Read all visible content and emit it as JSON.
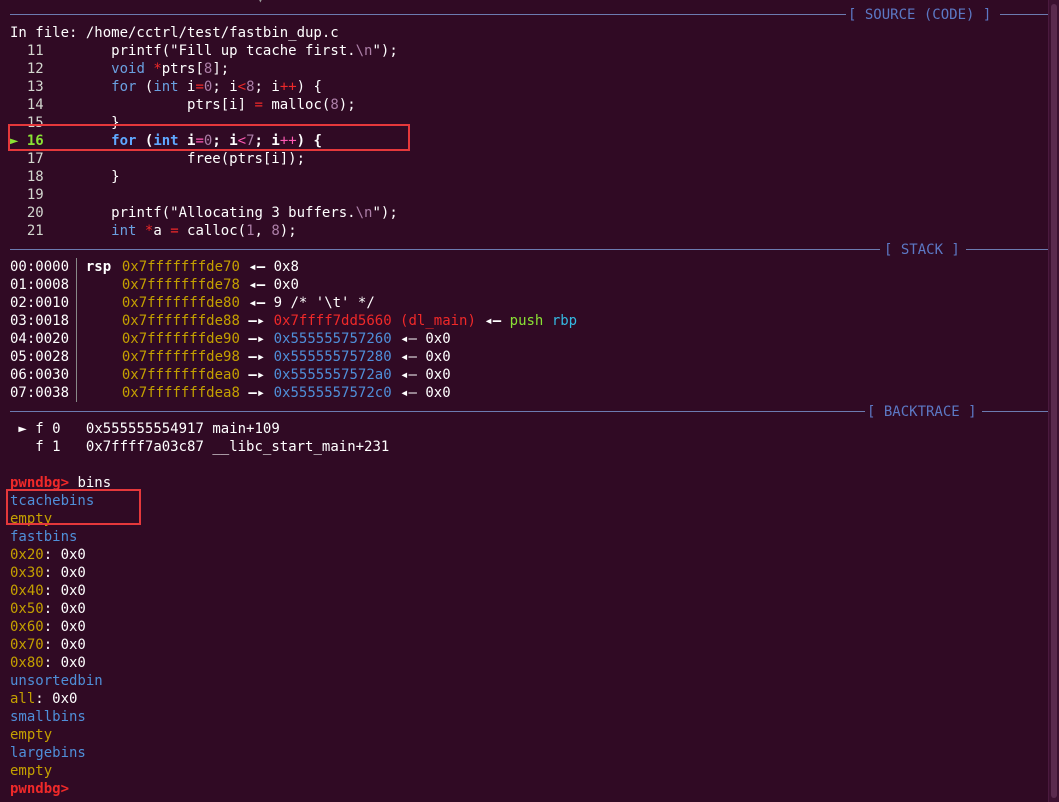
{
  "terminal": {
    "sections": {
      "source": "[ SOURCE (CODE) ]",
      "stack": "[ STACK ]",
      "backtrace": "[ BACKTRACE ]"
    },
    "file_line": {
      "prefix": "In file: ",
      "path": "/home/cctrl/test/fastbin_dup.c"
    },
    "source_lines": [
      {
        "num": "11",
        "code": [
          {
            "t": "printf(",
            "c": "white"
          },
          {
            "t": "\"Fill up tcache first.",
            "c": "white"
          },
          {
            "t": "\\n",
            "c": "purple"
          },
          {
            "t": "\");",
            "c": "white"
          }
        ]
      },
      {
        "num": "12",
        "code": [
          {
            "t": "void",
            "c": "blue2"
          },
          {
            "t": " ",
            "c": "white"
          },
          {
            "t": "*",
            "c": "red"
          },
          {
            "t": "ptrs[",
            "c": "white"
          },
          {
            "t": "8",
            "c": "purple"
          },
          {
            "t": "];",
            "c": "white"
          }
        ]
      },
      {
        "num": "13",
        "code": [
          {
            "t": "for",
            "c": "blue2"
          },
          {
            "t": " (",
            "c": "white"
          },
          {
            "t": "int",
            "c": "blue2"
          },
          {
            "t": " i",
            "c": "white"
          },
          {
            "t": "=",
            "c": "red"
          },
          {
            "t": "0",
            "c": "purple"
          },
          {
            "t": "; i",
            "c": "white"
          },
          {
            "t": "<",
            "c": "red"
          },
          {
            "t": "8",
            "c": "purple"
          },
          {
            "t": "; i",
            "c": "white"
          },
          {
            "t": "++",
            "c": "red"
          },
          {
            "t": ") {",
            "c": "white"
          }
        ]
      },
      {
        "num": "14",
        "code": [
          {
            "t": "         ptrs[i] ",
            "c": "white"
          },
          {
            "t": "=",
            "c": "red"
          },
          {
            "t": " malloc(",
            "c": "white"
          },
          {
            "t": "8",
            "c": "purple"
          },
          {
            "t": ");",
            "c": "white"
          }
        ]
      },
      {
        "num": "15",
        "code": [
          {
            "t": "}",
            "c": "white"
          }
        ]
      },
      {
        "num": "16",
        "current": true,
        "code": [
          {
            "t": "for",
            "c": "kw"
          },
          {
            "t": " (",
            "c": "white"
          },
          {
            "t": "int",
            "c": "kw"
          },
          {
            "t": " i",
            "c": "white"
          },
          {
            "t": "=",
            "c": "pink"
          },
          {
            "t": "0",
            "c": "purple"
          },
          {
            "t": "; i",
            "c": "white"
          },
          {
            "t": "<",
            "c": "pink"
          },
          {
            "t": "7",
            "c": "purple"
          },
          {
            "t": "; i",
            "c": "white"
          },
          {
            "t": "++",
            "c": "pink"
          },
          {
            "t": ") {",
            "c": "white"
          }
        ]
      },
      {
        "num": "17",
        "code": [
          {
            "t": "         free(ptrs[i]);",
            "c": "white"
          }
        ]
      },
      {
        "num": "18",
        "code": [
          {
            "t": "}",
            "c": "white"
          }
        ]
      },
      {
        "num": "19",
        "code": []
      },
      {
        "num": "20",
        "code": [
          {
            "t": "printf(",
            "c": "white"
          },
          {
            "t": "\"Allocating 3 buffers.",
            "c": "white"
          },
          {
            "t": "\\n",
            "c": "purple"
          },
          {
            "t": "\");",
            "c": "white"
          }
        ]
      },
      {
        "num": "21",
        "code": [
          {
            "t": "int",
            "c": "blue2"
          },
          {
            "t": " ",
            "c": "white"
          },
          {
            "t": "*",
            "c": "red"
          },
          {
            "t": "a ",
            "c": "white"
          },
          {
            "t": "=",
            "c": "red"
          },
          {
            "t": " calloc(",
            "c": "white"
          },
          {
            "t": "1",
            "c": "purple"
          },
          {
            "t": ", ",
            "c": "white"
          },
          {
            "t": "8",
            "c": "purple"
          },
          {
            "t": ");",
            "c": "white"
          }
        ]
      }
    ],
    "current_marker": "►",
    "stack_rows": [
      {
        "off": "00:0000",
        "reg": "rsp",
        "addr": "0x7fffffffde70",
        "arrow": "◂—",
        "target": "",
        "target_color": "",
        "tail": "0x8",
        "extra": ""
      },
      {
        "off": "01:0008",
        "reg": "",
        "addr": "0x7fffffffde78",
        "arrow": "◂—",
        "target": "",
        "target_color": "",
        "tail": "0x0",
        "extra": ""
      },
      {
        "off": "02:0010",
        "reg": "",
        "addr": "0x7fffffffde80",
        "arrow": "◂—",
        "target": "",
        "target_color": "",
        "tail": "9 /* '\\t' */",
        "extra": ""
      },
      {
        "off": "03:0018",
        "reg": "",
        "addr": "0x7fffffffde88",
        "arrow": "—▸",
        "target": "0x7ffff7dd5660 (dl_main)",
        "target_color": "red",
        "tail": "◂— push",
        "extra": "rbp"
      },
      {
        "off": "04:0020",
        "reg": "",
        "addr": "0x7fffffffde90",
        "arrow": "—▸",
        "target": "0x555555757260",
        "target_color": "blue",
        "tail": "◂— 0x0",
        "extra": ""
      },
      {
        "off": "05:0028",
        "reg": "",
        "addr": "0x7fffffffde98",
        "arrow": "—▸",
        "target": "0x555555757280",
        "target_color": "blue",
        "tail": "◂— 0x0",
        "extra": ""
      },
      {
        "off": "06:0030",
        "reg": "",
        "addr": "0x7fffffffdea0",
        "arrow": "—▸",
        "target": "0x5555557572a0",
        "target_color": "blue",
        "tail": "◂— 0x0",
        "extra": ""
      },
      {
        "off": "07:0038",
        "reg": "",
        "addr": "0x7fffffffdea8",
        "arrow": "—▸",
        "target": "0x5555557572c0",
        "target_color": "blue",
        "tail": "◂— 0x0",
        "extra": ""
      }
    ],
    "backtrace_rows": [
      {
        "marker": "►",
        "frame": "f 0",
        "addr": "0x555555554917",
        "sym": "main+109"
      },
      {
        "marker": "",
        "frame": "f 1",
        "addr": "0x7ffff7a03c87",
        "sym": "__libc_start_main+231"
      }
    ],
    "prompt": "pwndbg>",
    "command": "bins",
    "bins_output": [
      {
        "parts": [
          {
            "t": "tcachebins",
            "c": "blue"
          }
        ]
      },
      {
        "parts": [
          {
            "t": "empty",
            "c": "gold"
          }
        ]
      },
      {
        "parts": [
          {
            "t": "fastbins",
            "c": "blue"
          }
        ]
      },
      {
        "parts": [
          {
            "t": "0x20",
            "c": "gold"
          },
          {
            "t": ": 0x0",
            "c": "white"
          }
        ]
      },
      {
        "parts": [
          {
            "t": "0x30",
            "c": "gold"
          },
          {
            "t": ": 0x0",
            "c": "white"
          }
        ]
      },
      {
        "parts": [
          {
            "t": "0x40",
            "c": "gold"
          },
          {
            "t": ": 0x0",
            "c": "white"
          }
        ]
      },
      {
        "parts": [
          {
            "t": "0x50",
            "c": "gold"
          },
          {
            "t": ": 0x0",
            "c": "white"
          }
        ]
      },
      {
        "parts": [
          {
            "t": "0x60",
            "c": "gold"
          },
          {
            "t": ": 0x0",
            "c": "white"
          }
        ]
      },
      {
        "parts": [
          {
            "t": "0x70",
            "c": "gold"
          },
          {
            "t": ": 0x0",
            "c": "white"
          }
        ]
      },
      {
        "parts": [
          {
            "t": "0x80",
            "c": "gold"
          },
          {
            "t": ": 0x0",
            "c": "white"
          }
        ]
      },
      {
        "parts": [
          {
            "t": "unsortedbin",
            "c": "blue"
          }
        ]
      },
      {
        "parts": [
          {
            "t": "all",
            "c": "gold"
          },
          {
            "t": ": 0x0",
            "c": "white"
          }
        ]
      },
      {
        "parts": [
          {
            "t": "smallbins",
            "c": "blue"
          }
        ]
      },
      {
        "parts": [
          {
            "t": "empty",
            "c": "gold"
          }
        ]
      },
      {
        "parts": [
          {
            "t": "largebins",
            "c": "blue"
          }
        ]
      },
      {
        "parts": [
          {
            "t": "empty",
            "c": "gold"
          }
        ]
      }
    ],
    "final_prompt": "pwndbg>",
    "colors": {
      "background": "#300a24",
      "highlight_box": "#e5383b",
      "gold": "#c4a000",
      "blue": "#4f8fd9",
      "red": "#ef2929"
    }
  }
}
